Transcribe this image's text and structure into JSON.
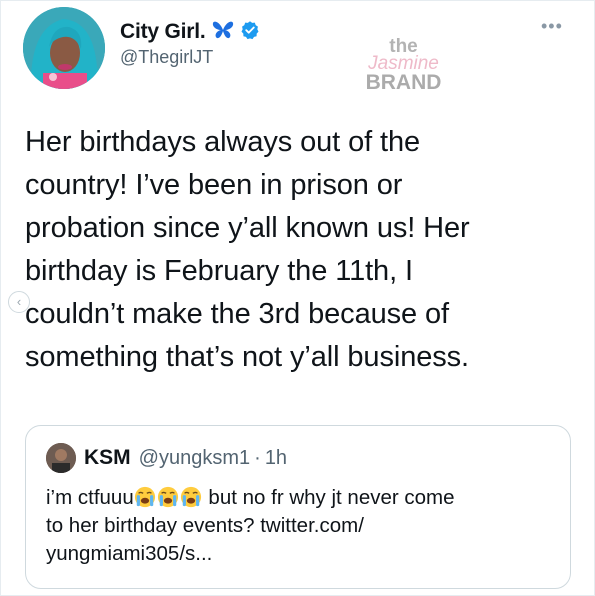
{
  "tweet": {
    "author_name": "City Girl.",
    "author_handle": "@ThegirlJT",
    "verified": true,
    "name_emoji": "butterfly-icon",
    "text_lines": [
      "Her birthdays always out of the",
      "country! I’ve been in prison or",
      "probation since y’all known us! Her",
      "birthday is February the 11th, I",
      "couldn’t make the 3rd because of",
      "something that’s not y’all business."
    ]
  },
  "watermark": {
    "line1": "the",
    "line2": "Jasmine",
    "line3": "BRAND"
  },
  "quote": {
    "author_name": "KSM",
    "author_handle": "@yungksm1",
    "separator": "·",
    "time": "1h",
    "line1_start": "i’m ctfuuu",
    "line1_emojis": [
      "loudly-crying-face-icon",
      "loudly-crying-face-icon",
      "loudly-crying-face-icon"
    ],
    "line1_end": " but no fr why jt never come",
    "line2": "to her birthday events? twitter.com/",
    "line3": "yungmiami305/s..."
  },
  "colors": {
    "verified_blue": "#1d9bf0",
    "butterfly_blue": "#1d6fe0",
    "text": "#0f1419",
    "secondary": "#536471",
    "border": "#cfd9de"
  }
}
